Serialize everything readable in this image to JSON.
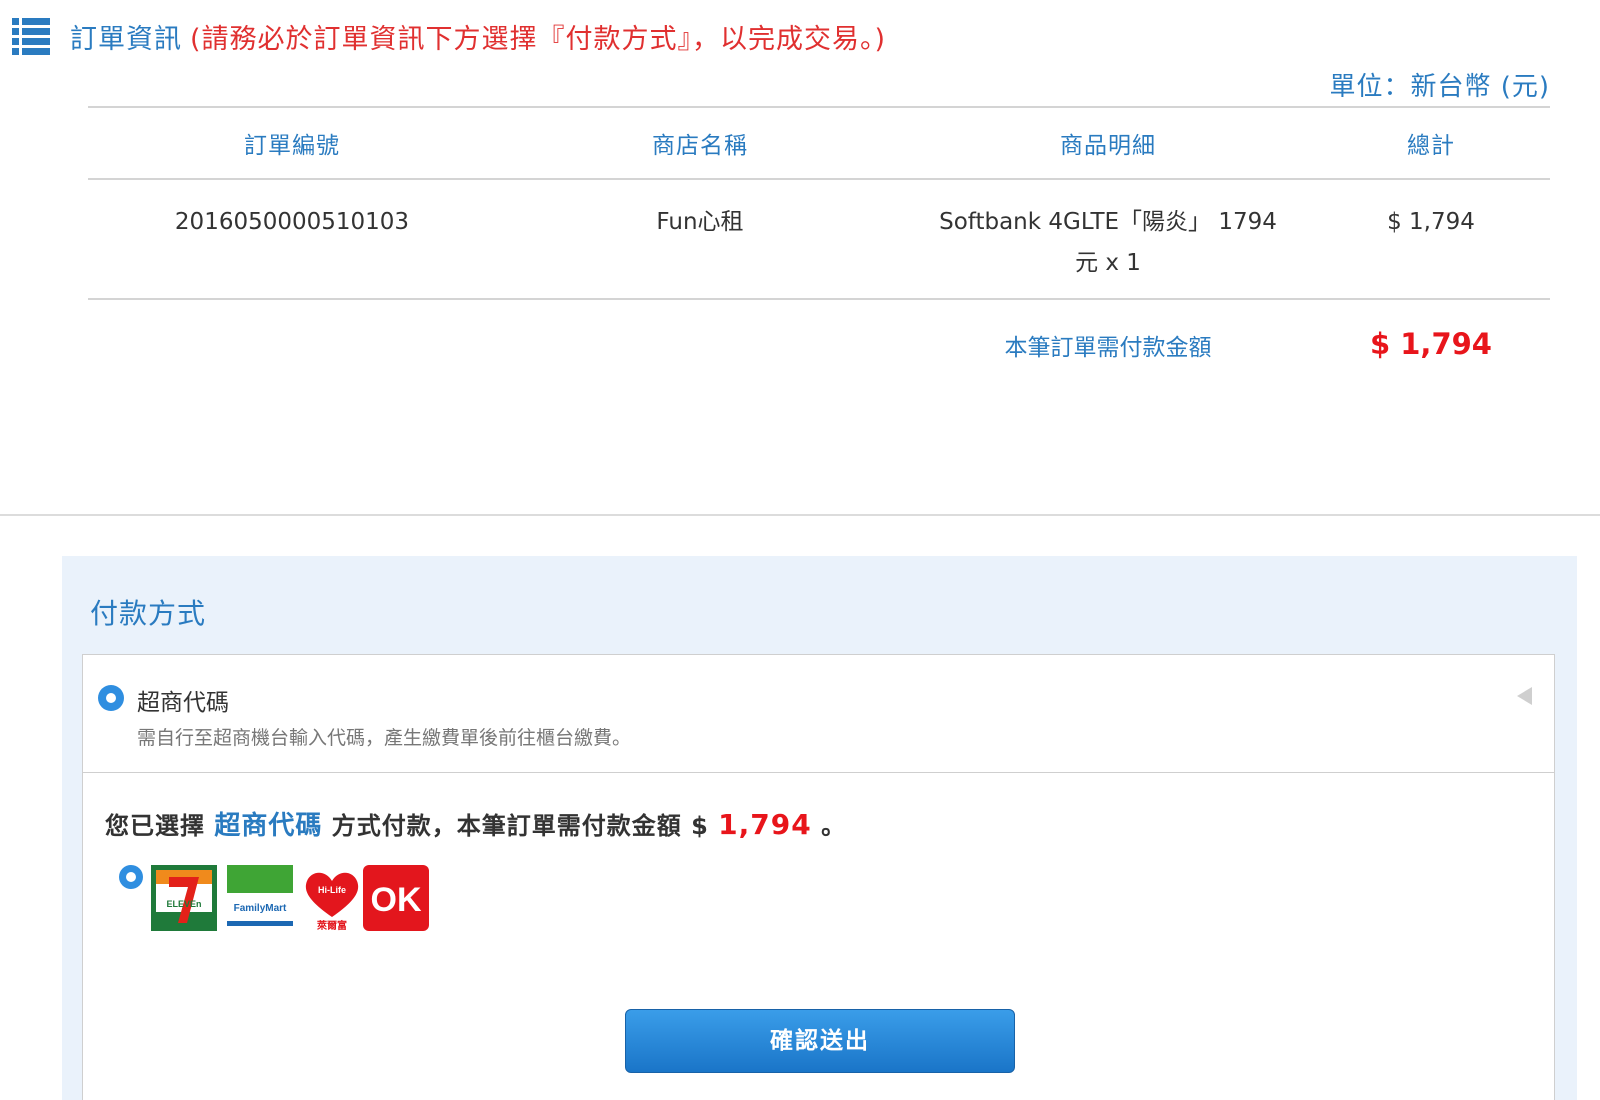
{
  "header": {
    "icon": "list-icon",
    "title": "訂單資訊",
    "notice": "(請務必於訂單資訊下方選擇『付款方式』，以完成交易。)",
    "unit": "單位：新台幣 (元)"
  },
  "table": {
    "columns": [
      "訂單編號",
      "商店名稱",
      "商品明細",
      "總計"
    ],
    "rows": [
      {
        "order_no": "2016050000510103",
        "store": "Fun心租",
        "detail": "Softbank 4GLTE「陽炎」 1794 元 x 1",
        "total": "$ 1,794"
      }
    ],
    "summary_label": "本筆訂單需付款金額",
    "summary_amount": "$ 1,794"
  },
  "payment": {
    "title": "付款方式",
    "method_name": "超商代碼",
    "method_desc": "需自行至超商機台輸入代碼，產生繳費單後前往櫃台繳費。",
    "selected_prefix": "您已選擇",
    "selected_method": "超商代碼",
    "selected_middle": "方式付款，本筆訂單需付款金額 $",
    "selected_amount": "1,794",
    "selected_suffix": "。",
    "store_logos": [
      "7-eleven-logo",
      "familymart-logo",
      "hilife-logo",
      "ok-mart-logo"
    ],
    "logo_text": {
      "eleven": "ELEVEn",
      "familymart": "FamilyMart",
      "hilife": "Hi-Life",
      "hilife_cn": "萊爾富",
      "ok": "OK"
    },
    "submit_label": "確認送出"
  },
  "colors": {
    "accent_blue": "#2a7bc0",
    "alert_red": "#e8151b",
    "panel_bg": "#eaf2fb",
    "button_blue": "#1a75c8"
  }
}
